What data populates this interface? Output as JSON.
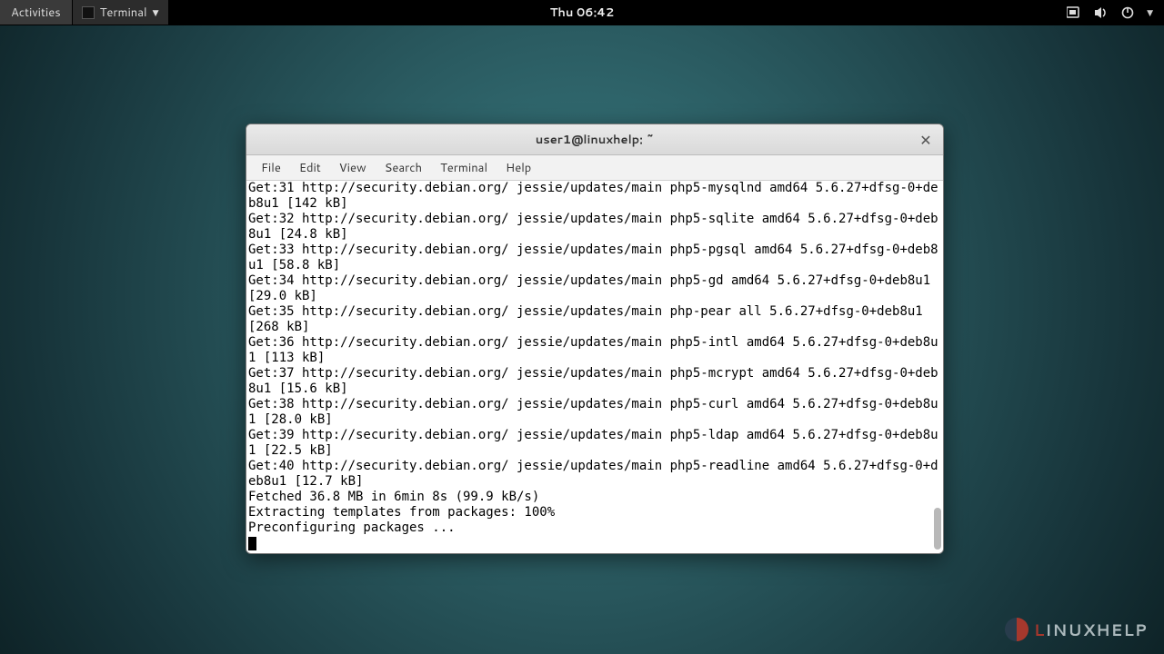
{
  "topbar": {
    "activities": "Activities",
    "app_name": "Terminal",
    "clock": "Thu 06:42"
  },
  "window": {
    "title": "user1@linuxhelp: ~",
    "menus": {
      "file": "File",
      "edit": "Edit",
      "view": "View",
      "search": "Search",
      "terminal": "Terminal",
      "help": "Help"
    }
  },
  "terminal_output": "Get:31 http://security.debian.org/ jessie/updates/main php5-mysqlnd amd64 5.6.27+dfsg-0+deb8u1 [142 kB]\nGet:32 http://security.debian.org/ jessie/updates/main php5-sqlite amd64 5.6.27+dfsg-0+deb8u1 [24.8 kB]\nGet:33 http://security.debian.org/ jessie/updates/main php5-pgsql amd64 5.6.27+dfsg-0+deb8u1 [58.8 kB]\nGet:34 http://security.debian.org/ jessie/updates/main php5-gd amd64 5.6.27+dfsg-0+deb8u1 [29.0 kB]\nGet:35 http://security.debian.org/ jessie/updates/main php-pear all 5.6.27+dfsg-0+deb8u1 [268 kB]\nGet:36 http://security.debian.org/ jessie/updates/main php5-intl amd64 5.6.27+dfsg-0+deb8u1 [113 kB]\nGet:37 http://security.debian.org/ jessie/updates/main php5-mcrypt amd64 5.6.27+dfsg-0+deb8u1 [15.6 kB]\nGet:38 http://security.debian.org/ jessie/updates/main php5-curl amd64 5.6.27+dfsg-0+deb8u1 [28.0 kB]\nGet:39 http://security.debian.org/ jessie/updates/main php5-ldap amd64 5.6.27+dfsg-0+deb8u1 [22.5 kB]\nGet:40 http://security.debian.org/ jessie/updates/main php5-readline amd64 5.6.27+dfsg-0+deb8u1 [12.7 kB]\nFetched 36.8 MB in 6min 8s (99.9 kB/s)\nExtracting templates from packages: 100%\nPreconfiguring packages ...",
  "watermark": {
    "text_l": "L",
    "text_rest": "INUXHELP"
  }
}
